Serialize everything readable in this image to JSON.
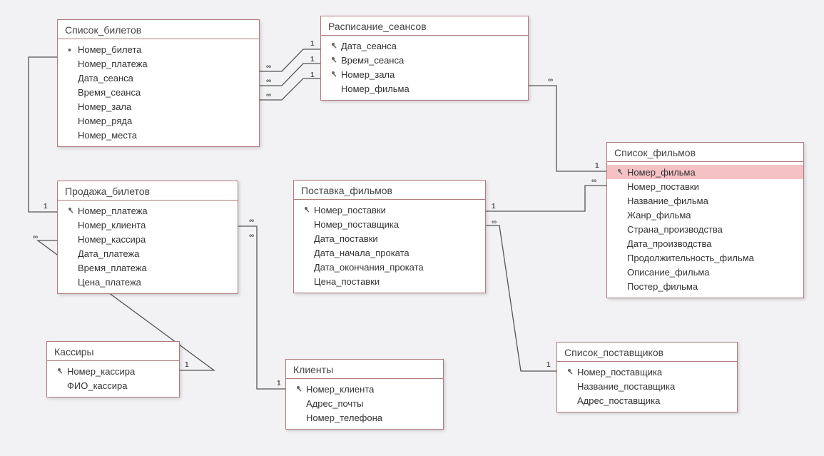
{
  "entities": {
    "tickets": {
      "title": "Список_билетов"
    },
    "schedule": {
      "title": "Расписание_сеансов"
    },
    "sales": {
      "title": "Продажа_билетов"
    },
    "supply": {
      "title": "Поставка_фильмов"
    },
    "films": {
      "title": "Список_фильмов"
    },
    "cashiers": {
      "title": "Кассиры"
    },
    "clients": {
      "title": "Клиенты"
    },
    "suppliers": {
      "title": "Список_поставщиков"
    }
  },
  "fields": {
    "tickets": {
      "f0": "Номер_билета",
      "f1": "Номер_платежа",
      "f2": "Дата_сеанса",
      "f3": "Время_сеанса",
      "f4": "Номер_зала",
      "f5": "Номер_ряда",
      "f6": "Номер_места"
    },
    "schedule": {
      "f0": "Дата_сеанса",
      "f1": "Время_сеанса",
      "f2": "Номер_зала",
      "f3": "Номер_фильма"
    },
    "sales": {
      "f0": "Номер_платежа",
      "f1": "Номер_клиента",
      "f2": "Номер_кассира",
      "f3": "Дата_платежа",
      "f4": "Время_платежа",
      "f5": "Цена_платежа"
    },
    "supply": {
      "f0": "Номер_поставки",
      "f1": "Номер_поставщика",
      "f2": "Дата_поставки",
      "f3": "Дата_начала_проката",
      "f4": "Дата_окончания_проката",
      "f5": "Цена_поставки"
    },
    "films": {
      "f0": "Номер_фильма",
      "f1": "Номер_поставки",
      "f2": "Название_фильма",
      "f3": "Жанр_фильма",
      "f4": "Страна_производства",
      "f5": "Дата_производства",
      "f6": "Продолжительность_фильма",
      "f7": "Описание_фильма",
      "f8": "Постер_фильма"
    },
    "cashiers": {
      "f0": "Номер_кассира",
      "f1": "ФИО_кассира"
    },
    "clients": {
      "f0": "Номер_клиента",
      "f1": "Адрес_почты",
      "f2": "Номер_телефона"
    },
    "suppliers": {
      "f0": "Номер_поставщика",
      "f1": "Название_поставщика",
      "f2": "Адрес_поставщика"
    }
  },
  "rel_labels": {
    "one": "1",
    "many": "∞"
  },
  "chart_data": {
    "type": "entity-relationship",
    "entities": [
      {
        "name": "Список_билетов",
        "fields": [
          "Номер_билета",
          "Номер_платежа",
          "Дата_сеанса",
          "Время_сеанса",
          "Номер_зала",
          "Номер_ряда",
          "Номер_места"
        ],
        "primary_key": [
          "Номер_билета"
        ]
      },
      {
        "name": "Расписание_сеансов",
        "fields": [
          "Дата_сеанса",
          "Время_сеанса",
          "Номер_зала",
          "Номер_фильма"
        ],
        "primary_key": [
          "Дата_сеанса",
          "Время_сеанса",
          "Номер_зала"
        ]
      },
      {
        "name": "Продажа_билетов",
        "fields": [
          "Номер_платежа",
          "Номер_клиента",
          "Номер_кассира",
          "Дата_платежа",
          "Время_платежа",
          "Цена_платежа"
        ],
        "primary_key": [
          "Номер_платежа"
        ]
      },
      {
        "name": "Поставка_фильмов",
        "fields": [
          "Номер_поставки",
          "Номер_поставщика",
          "Дата_поставки",
          "Дата_начала_проката",
          "Дата_окончания_проката",
          "Цена_поставки"
        ],
        "primary_key": [
          "Номер_поставки"
        ]
      },
      {
        "name": "Список_фильмов",
        "fields": [
          "Номер_фильма",
          "Номер_поставки",
          "Название_фильма",
          "Жанр_фильма",
          "Страна_производства",
          "Дата_производства",
          "Продолжительность_фильма",
          "Описание_фильма",
          "Постер_фильма"
        ],
        "primary_key": [
          "Номер_фильма"
        ]
      },
      {
        "name": "Кассиры",
        "fields": [
          "Номер_кассира",
          "ФИО_кассира"
        ],
        "primary_key": [
          "Номер_кассира"
        ]
      },
      {
        "name": "Клиенты",
        "fields": [
          "Номер_клиента",
          "Адрес_почты",
          "Номер_телефона"
        ],
        "primary_key": [
          "Номер_клиента"
        ]
      },
      {
        "name": "Список_поставщиков",
        "fields": [
          "Номер_поставщика",
          "Название_поставщика",
          "Адрес_поставщика"
        ],
        "primary_key": [
          "Номер_поставщика"
        ]
      }
    ],
    "relationships": [
      {
        "from": "Расписание_сеансов",
        "from_field": "Дата_сеанса",
        "to": "Список_билетов",
        "to_field": "Дата_сеанса",
        "cardinality": "1..∞"
      },
      {
        "from": "Расписание_сеансов",
        "from_field": "Время_сеанса",
        "to": "Список_билетов",
        "to_field": "Время_сеанса",
        "cardinality": "1..∞"
      },
      {
        "from": "Расписание_сеансов",
        "from_field": "Номер_зала",
        "to": "Список_билетов",
        "to_field": "Номер_зала",
        "cardinality": "1..∞"
      },
      {
        "from": "Продажа_билетов",
        "from_field": "Номер_платежа",
        "to": "Список_билетов",
        "to_field": "Номер_платежа",
        "cardinality": "1..∞"
      },
      {
        "from": "Кассиры",
        "from_field": "Номер_кассира",
        "to": "Продажа_билетов",
        "to_field": "Номер_кассира",
        "cardinality": "1..∞"
      },
      {
        "from": "Клиенты",
        "from_field": "Номер_клиента",
        "to": "Продажа_билетов",
        "to_field": "Номер_клиента",
        "cardinality": "1..∞"
      },
      {
        "from": "Список_фильмов",
        "from_field": "Номер_фильма",
        "to": "Расписание_сеансов",
        "to_field": "Номер_фильма",
        "cardinality": "1..∞"
      },
      {
        "from": "Поставка_фильмов",
        "from_field": "Номер_поставки",
        "to": "Список_фильмов",
        "to_field": "Номер_поставки",
        "cardinality": "1..∞"
      },
      {
        "from": "Список_поставщиков",
        "from_field": "Номер_поставщика",
        "to": "Поставка_фильмов",
        "to_field": "Номер_поставщика",
        "cardinality": "1..∞"
      }
    ]
  }
}
